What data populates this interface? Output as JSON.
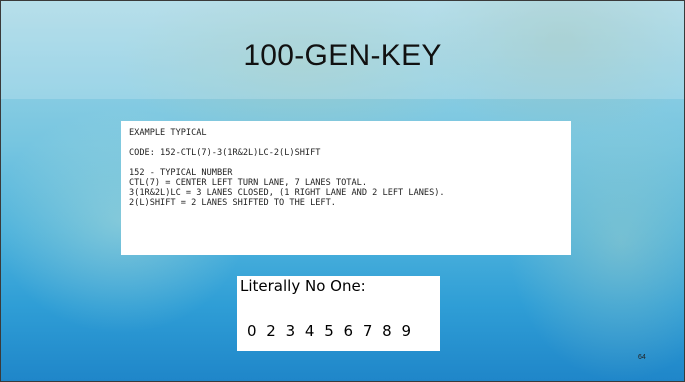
{
  "slide": {
    "title": "100-GEN-KEY",
    "example": {
      "heading": "EXAMPLE TYPICAL",
      "code": "CODE: 152-CTL(7)-3(1R&2L)LC-2(L)SHIFT",
      "lines": [
        "152 - TYPICAL NUMBER",
        "CTL(7) = CENTER LEFT TURN LANE, 7 LANES TOTAL.",
        "3(1R&2L)LC = 3 LANES CLOSED, (1 RIGHT LANE AND 2 LEFT LANES).",
        "2(L)SHIFT = 2 LANES SHIFTED TO THE LEFT."
      ]
    },
    "meme": {
      "caption": "Literally No One:",
      "digits": "0 2 3 4 5 6 7 8 9"
    },
    "page_number": "64"
  }
}
